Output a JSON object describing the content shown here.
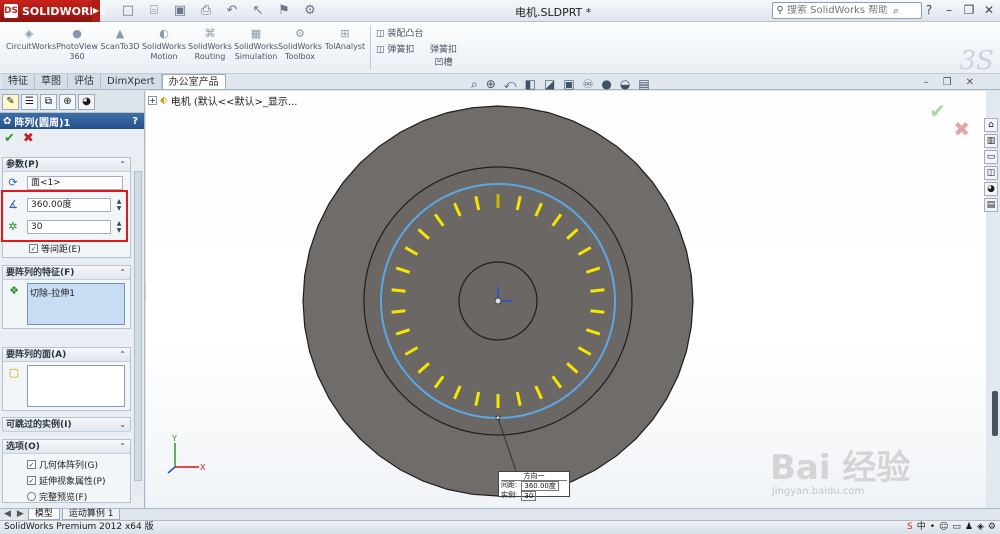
{
  "app": {
    "logo_text": "SOLIDWORKS",
    "logo_mark": "DS",
    "document_title": "电机.SLDPRT *",
    "search_placeholder": "搜索 SolidWorks 帮助"
  },
  "quick_icons": [
    "new-icon",
    "open-icon",
    "save-icon",
    "print-icon",
    "undo-icon",
    "select-icon",
    "rebuild-icon",
    "options-icon"
  ],
  "ribbon": {
    "buttons": [
      {
        "line1": "CircuitWorks",
        "line2": ""
      },
      {
        "line1": "PhotoView",
        "line2": "360"
      },
      {
        "line1": "ScanTo3D",
        "line2": ""
      },
      {
        "line1": "SolidWorks",
        "line2": "Motion"
      },
      {
        "line1": "SolidWorks",
        "line2": "Routing"
      },
      {
        "line1": "SolidWorks",
        "line2": "Simulation"
      },
      {
        "line1": "SolidWorks",
        "line2": "Toolbox"
      },
      {
        "line1": "TolAnalyst",
        "line2": ""
      }
    ],
    "small": [
      "装配凸台",
      "弹簧扣",
      "弹簧扣",
      "凹槽"
    ]
  },
  "tabs": [
    "特征",
    "草图",
    "评估",
    "DimXpert",
    "办公室产品"
  ],
  "active_tab": "办公室产品",
  "panel": {
    "title": "阵列(圆周)1",
    "help": "?",
    "params": {
      "header": "参数(P)",
      "axis": "面<1>",
      "angle": "360.00度",
      "count": "30",
      "equal_spacing": "等间距(E)"
    },
    "features": {
      "header": "要阵列的特征(F)",
      "item": "切除-拉伸1"
    },
    "faces": {
      "header": "要阵列的面(A)"
    },
    "skip": {
      "header": "可跳过的实例(I)"
    },
    "options": {
      "header": "选项(O)",
      "geometry": "几何体阵列(G)",
      "visual": "延伸视象属性(P)",
      "preview": "完整预览(F)"
    }
  },
  "viewport": {
    "tree_label": "电机  (默认<<默认>_显示...",
    "callout": {
      "header": "方向一",
      "spacing_label": "间距:",
      "spacing_value": "360.00度",
      "count_label": "实例:",
      "count_value": "30"
    },
    "axes": {
      "x": "X",
      "y": "Y"
    }
  },
  "watermark": {
    "main": "Bai 经验",
    "url": "jingyan.baidu.com"
  },
  "bottom_tabs": [
    "模型",
    "运动算例 1"
  ],
  "status": {
    "text": "SolidWorks Premium 2012 x64 版",
    "tray_text": "中"
  },
  "colors": {
    "accent_red": "#e2191b",
    "part_gray": "#6f6c69",
    "pattern_yellow": "#f5e600",
    "circle_blue": "#5aa9e6"
  }
}
